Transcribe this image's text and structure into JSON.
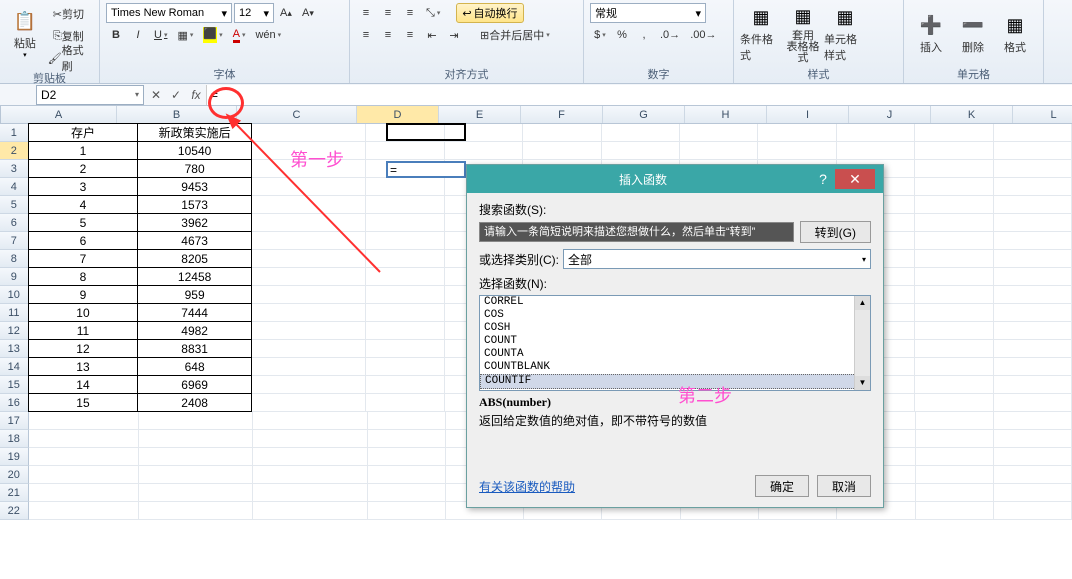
{
  "ribbon": {
    "clipboard": {
      "cut": "剪切",
      "copy": "复制",
      "brush": "格式刷",
      "paste": "粘贴",
      "label": "剪贴板"
    },
    "font": {
      "name": "Times New Roman",
      "size": "12",
      "bold": "B",
      "italic": "I",
      "underline": "U",
      "label": "字体"
    },
    "align": {
      "wrap": "自动换行",
      "merge": "合并后居中",
      "label": "对齐方式"
    },
    "number": {
      "format": "常规",
      "label": "数字"
    },
    "styles": {
      "cond": "条件格式",
      "table": "套用\n表格格式",
      "cell": "单元格样式",
      "label": "样式"
    },
    "cells": {
      "insert": "插入",
      "delete": "删除",
      "format": "格式",
      "label": "单元格"
    }
  },
  "formula_bar": {
    "name_box": "D2",
    "cancel": "✕",
    "enter": "✓",
    "fx": "fx",
    "formula": "="
  },
  "grid": {
    "cols": [
      "A",
      "B",
      "C",
      "D",
      "E",
      "F",
      "G",
      "H",
      "I",
      "J",
      "K",
      "L"
    ],
    "headers": {
      "A": "存户",
      "B": "新政策实施后"
    },
    "data": [
      {
        "a": "1",
        "b": "10540"
      },
      {
        "a": "2",
        "b": "780"
      },
      {
        "a": "3",
        "b": "9453"
      },
      {
        "a": "4",
        "b": "1573"
      },
      {
        "a": "5",
        "b": "3962"
      },
      {
        "a": "6",
        "b": "4673"
      },
      {
        "a": "7",
        "b": "8205"
      },
      {
        "a": "8",
        "b": "12458"
      },
      {
        "a": "9",
        "b": "959"
      },
      {
        "a": "10",
        "b": "7444"
      },
      {
        "a": "11",
        "b": "4982"
      },
      {
        "a": "12",
        "b": "8831"
      },
      {
        "a": "13",
        "b": "648"
      },
      {
        "a": "14",
        "b": "6969"
      },
      {
        "a": "15",
        "b": "2408"
      }
    ],
    "edit_value": "="
  },
  "dialog": {
    "title": "插入函数",
    "search_label": "搜索函数(S):",
    "search_placeholder": "请输入一条简短说明来描述您想做什么，然后单击“转到”",
    "go": "转到(G)",
    "cat_label": "或选择类别(C):",
    "cat_value": "全部",
    "list_label": "选择函数(N):",
    "funcs": [
      "CORREL",
      "COS",
      "COSH",
      "COUNT",
      "COUNTA",
      "COUNTBLANK",
      "COUNTIF"
    ],
    "selected_func": "COUNTIF",
    "sig": "ABS(number)",
    "desc": "返回给定数值的绝对值，即不带符号的数值",
    "help_link": "有关该函数的帮助",
    "ok": "确定",
    "cancel": "取消"
  },
  "annotations": {
    "step1": "第一步",
    "step2": "第二步"
  }
}
